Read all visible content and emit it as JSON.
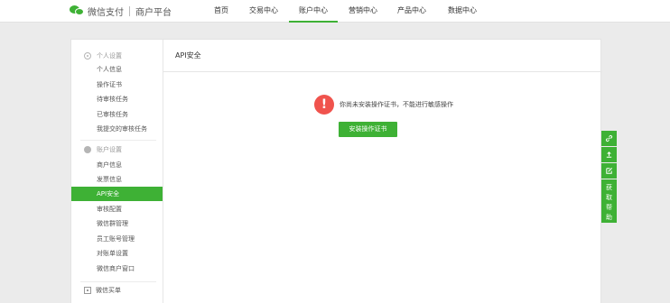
{
  "brand": {
    "name": "微信支付",
    "subtitle": "商户平台"
  },
  "nav": {
    "items": [
      {
        "label": "首页"
      },
      {
        "label": "交易中心"
      },
      {
        "label": "账户中心",
        "active": true
      },
      {
        "label": "营销中心"
      },
      {
        "label": "产品中心"
      },
      {
        "label": "数据中心"
      }
    ]
  },
  "sidebar": {
    "group1": {
      "title": "个人设置",
      "items": [
        "个人信息",
        "操作证书",
        "待审核任务",
        "已审核任务",
        "我提交的审核任务"
      ]
    },
    "group2": {
      "title": "账户设置",
      "items": [
        "商户信息",
        "发票信息",
        "API安全",
        "审核配置",
        "微信群管理",
        "员工账号管理",
        "对账单设置",
        "微信商户窗口"
      ]
    },
    "active_item": "API安全",
    "bottom_link": "微信买单"
  },
  "content": {
    "title": "API安全",
    "notice": "你尚未安装操作证书，不能进行敏感操作",
    "install_button": "安装操作证书"
  },
  "float_toolbar": {
    "icons": [
      "link-icon",
      "upload-icon",
      "edit-icon"
    ],
    "help_label": [
      "获",
      "取",
      "帮",
      "助"
    ]
  },
  "colors": {
    "accent": "#3eb135",
    "warning": "#f0534d",
    "background": "#ebebeb"
  }
}
